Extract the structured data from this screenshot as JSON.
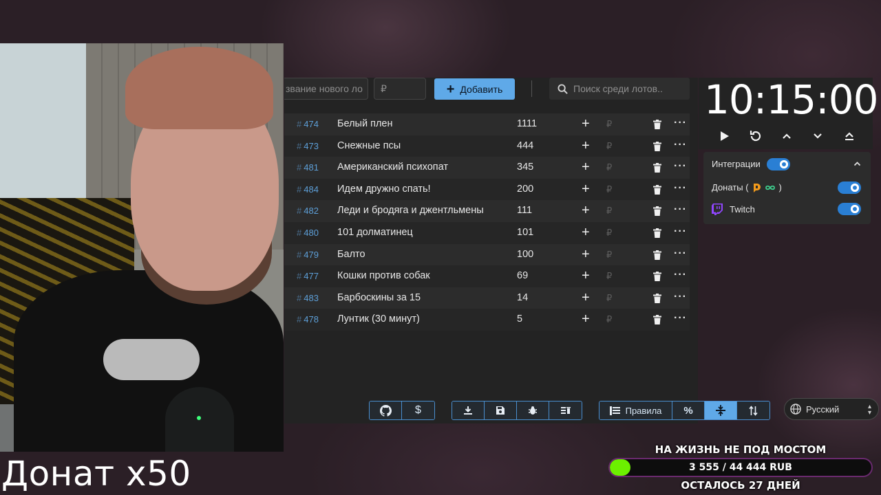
{
  "overlay": {
    "caption": "Донат x50"
  },
  "toolbar": {
    "name_placeholder": "звание нового ло",
    "price_placeholder": "₽",
    "add_label": "Добавить",
    "search_placeholder": "Поиск среди лотов.."
  },
  "lots": [
    {
      "id": "474",
      "name": "Белый плен",
      "amount": "1111"
    },
    {
      "id": "473",
      "name": "Снежные псы",
      "amount": "444"
    },
    {
      "id": "481",
      "name": "Американский психопат",
      "amount": "345"
    },
    {
      "id": "484",
      "name": "Идем дружно спать!",
      "amount": "200"
    },
    {
      "id": "482",
      "name": "Леди и бродяга и джентльмены",
      "amount": "111"
    },
    {
      "id": "480",
      "name": "101 долматинец",
      "amount": "101"
    },
    {
      "id": "479",
      "name": "Балто",
      "amount": "100"
    },
    {
      "id": "477",
      "name": "Кошки против собак",
      "amount": "69"
    },
    {
      "id": "483",
      "name": "Барбоскины за 15",
      "amount": "14"
    },
    {
      "id": "478",
      "name": "Лунтик (30 минут)",
      "amount": "5"
    }
  ],
  "lot_symbols": {
    "hash": "#",
    "plus": "+",
    "currency": "₽",
    "more": "···"
  },
  "bottom_toolbar": {
    "rules_label": "Правила",
    "percent_label": "%",
    "dollar_label": "$"
  },
  "language": {
    "selected": "Русский"
  },
  "timer": {
    "value": "10:15:00"
  },
  "integrations": {
    "title": "Интеграции",
    "donations_label": "Донаты (",
    "donations_suffix": ")",
    "twitch_label": "Twitch",
    "enabled": true
  },
  "goal": {
    "title": "НА ЖИЗНЬ НЕ ПОД МОСТОМ",
    "progress_text": "3 555 / 44 444 RUB",
    "remaining": "ОСТАЛОСЬ 27 ДНЕЙ",
    "current": 3555,
    "target": 44444
  },
  "colors": {
    "accent": "#5fa9e8",
    "toggle_on": "#2a7fd4",
    "goal_fill": "#6cf000",
    "donationalerts": "#f29a1b",
    "twitch": "#9146ff"
  }
}
